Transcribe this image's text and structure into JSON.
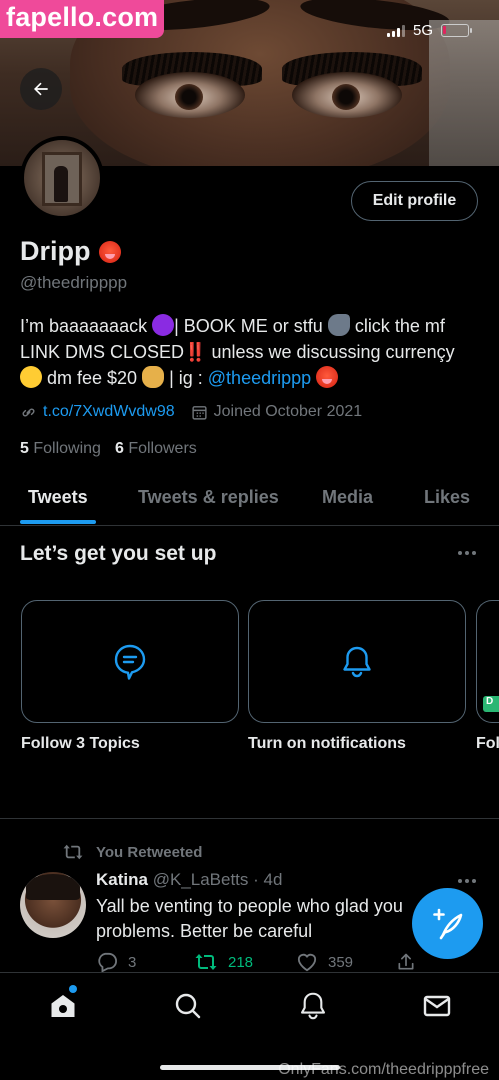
{
  "watermark": {
    "text": "fapello.com"
  },
  "status_bar": {
    "network": "5G",
    "battery_level": 0.15,
    "battery_color": "#e0245e"
  },
  "profile": {
    "name": "Dripp",
    "handle": "@theedripppp",
    "edit_button": "Edit profile",
    "bio": {
      "part1": "I’m baaaaaaack ",
      "part2": "| BOOK ME or stfu ",
      "part3": " click the mf LINK DMS CLOSED",
      "part4": " unless we discussing currençy ",
      "part5": " dm fee $20",
      "part6": " | ig : ",
      "mention": "@theedrippp",
      "double_exclamation": "‼️"
    },
    "link": "t.co/7XwdWvdw98",
    "joined": "Joined October 2021",
    "following_count": "5",
    "following_label": "Following",
    "followers_count": "6",
    "followers_label": "Followers"
  },
  "tabs": [
    {
      "label": "Tweets",
      "active": true
    },
    {
      "label": "Tweets & replies",
      "active": false
    },
    {
      "label": "Media",
      "active": false
    },
    {
      "label": "Likes",
      "active": false
    }
  ],
  "setup": {
    "title": "Let’s get you set up",
    "cards": [
      {
        "label": "Follow 3 Topics",
        "icon": "topic-bubble-icon"
      },
      {
        "label": "Turn on notifications",
        "icon": "bell-icon"
      },
      {
        "label": "Fol",
        "icon": "partial-card"
      }
    ],
    "partial_tag": "D"
  },
  "tweet": {
    "retweet_label": "You Retweeted",
    "author_name": "Katina",
    "author_handle": "@K_LaBetts",
    "time": "· 4d",
    "text": "Yall be venting to people who glad you problems. Better be careful",
    "replies": "3",
    "retweets": "218",
    "likes": "359"
  },
  "nav": {
    "items": [
      "home-icon",
      "search-icon",
      "notifications-icon",
      "messages-icon"
    ]
  },
  "footer_watermark": "OnlyFans.com/theedripppfree",
  "colors": {
    "accent": "#1d9bf0",
    "retweet_green": "#00ba7c",
    "muted": "#71767b",
    "watermark_pink": "#ef4a9a"
  }
}
